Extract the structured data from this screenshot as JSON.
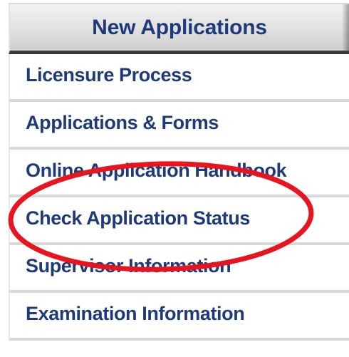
{
  "header": {
    "title": "New Applications"
  },
  "menu": {
    "items": [
      {
        "label": "Licensure Process"
      },
      {
        "label": "Applications & Forms"
      },
      {
        "label": "Online Application Handbook"
      },
      {
        "label": "Check Application Status"
      },
      {
        "label": "Supervisor Information"
      },
      {
        "label": "Examination Information"
      }
    ]
  },
  "annotation": {
    "color": "#e8141e",
    "highlighted_item": "Check Application Status"
  },
  "colors": {
    "link": "#1e3a7a",
    "header_bg": "#dcdcdc",
    "divider": "#d9d9d9"
  }
}
